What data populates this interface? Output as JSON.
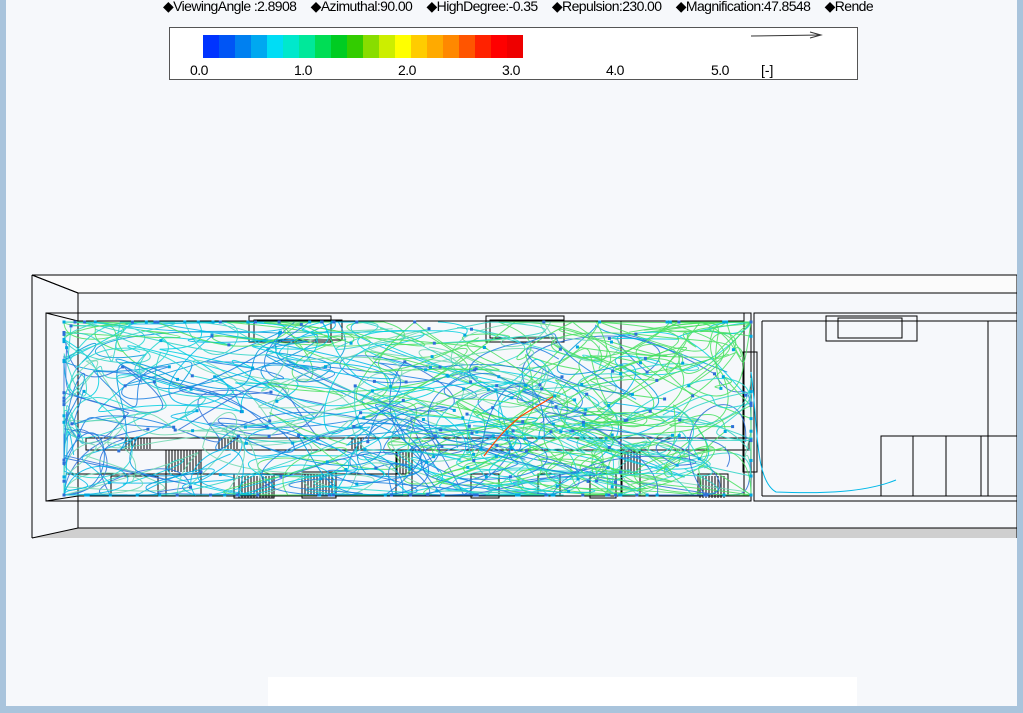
{
  "params": {
    "viewing_angle": "◆ViewingAngle :2.8908",
    "azimuthal": "◆Azimuthal:90.00",
    "high_degree": "◆HighDegree:-0.35",
    "repulsion": "◆Repulsion:230.00",
    "magnification": "◆Magnification:47.8548",
    "render": "◆Rende"
  },
  "legend": {
    "ticks": [
      "0.0",
      "1.0",
      "2.0",
      "3.0",
      "4.0",
      "5.0"
    ],
    "unit": "[-]",
    "colors": [
      "#0033ff",
      "#0055f5",
      "#0080f0",
      "#00a8f0",
      "#00ddf5",
      "#00e8cc",
      "#00e89a",
      "#00dd55",
      "#00cc22",
      "#33cc00",
      "#88dd00",
      "#ccee00",
      "#ffff00",
      "#ffcc00",
      "#ffaa00",
      "#ff8800",
      "#ff5500",
      "#ff2200",
      "#ff0000",
      "#ee0000"
    ]
  },
  "scene": {
    "streamline_colors": [
      "#00cfe0",
      "#22d6d0",
      "#0099dd",
      "#1a7fe0",
      "#2fd4c6",
      "#00b8e8",
      "#6ed8b0",
      "#48e060",
      "#2c6fd8"
    ],
    "stroke_color": "#000000"
  }
}
